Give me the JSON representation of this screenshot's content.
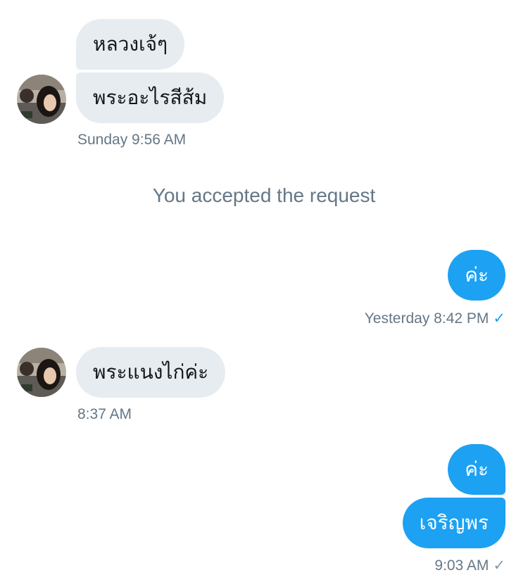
{
  "conversation": {
    "messages": [
      {
        "text": "หลวงเจ้ๆ",
        "side": "incoming"
      },
      {
        "text": "พระอะไรสีส้ม",
        "side": "incoming"
      },
      {
        "timestamp": "Sunday 9:56 AM"
      },
      {
        "system": "You accepted the request"
      },
      {
        "text": "ค่ะ",
        "side": "outgoing"
      },
      {
        "timestamp": "Yesterday 8:42 PM"
      },
      {
        "text": "พระแนงไก่ค่ะ",
        "side": "incoming"
      },
      {
        "timestamp": "8:37 AM"
      },
      {
        "text": "ค่ะ",
        "side": "outgoing"
      },
      {
        "text": "เจริญพร",
        "side": "outgoing"
      },
      {
        "timestamp": "9:03 AM"
      }
    ],
    "checkmark_glyph": "✓"
  },
  "colors": {
    "incoming_bubble": "#e6ecf0",
    "outgoing_bubble": "#1da1f2",
    "timestamp_text": "#657786",
    "sent_check": "#1da1f2",
    "read_check": "#8899a6"
  },
  "icons": {
    "avatar": "contact-avatar-photo",
    "status": "checkmark-icon"
  }
}
